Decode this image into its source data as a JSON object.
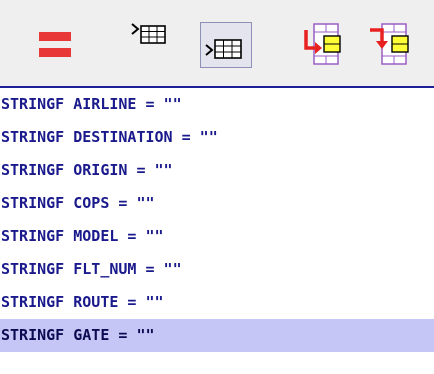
{
  "colors": {
    "toolbar_bg": "#efefef",
    "border_accent": "#1e1e96",
    "code_text": "#1a1a8c",
    "selection_bg": "#c6c6f6",
    "equals_icon": "#e83838",
    "subtable_yellow": "#ffff38",
    "subtable_red": "#e82020",
    "subtable_frame": "#9a5ec4"
  },
  "toolbar": {
    "buttons": [
      {
        "icon": "red-equals-icon",
        "pressed": false
      },
      {
        "icon": "insert-row-before-table-icon",
        "pressed": false
      },
      {
        "icon": "insert-row-after-table-icon",
        "pressed": true
      },
      {
        "icon": "insert-subtable-arrow-icon",
        "pressed": false
      },
      {
        "icon": "insert-subtable-down-icon",
        "pressed": false
      }
    ]
  },
  "editor": {
    "lines": [
      "STRINGF AIRLINE = \"\"",
      "STRINGF DESTINATION = \"\"",
      "STRINGF ORIGIN = \"\"",
      "STRINGF COPS = \"\"",
      "STRINGF MODEL = \"\"",
      "STRINGF FLT_NUM = \"\"",
      "STRINGF ROUTE = \"\"",
      "STRINGF GATE = \"\""
    ],
    "selected_line_index": 7
  }
}
